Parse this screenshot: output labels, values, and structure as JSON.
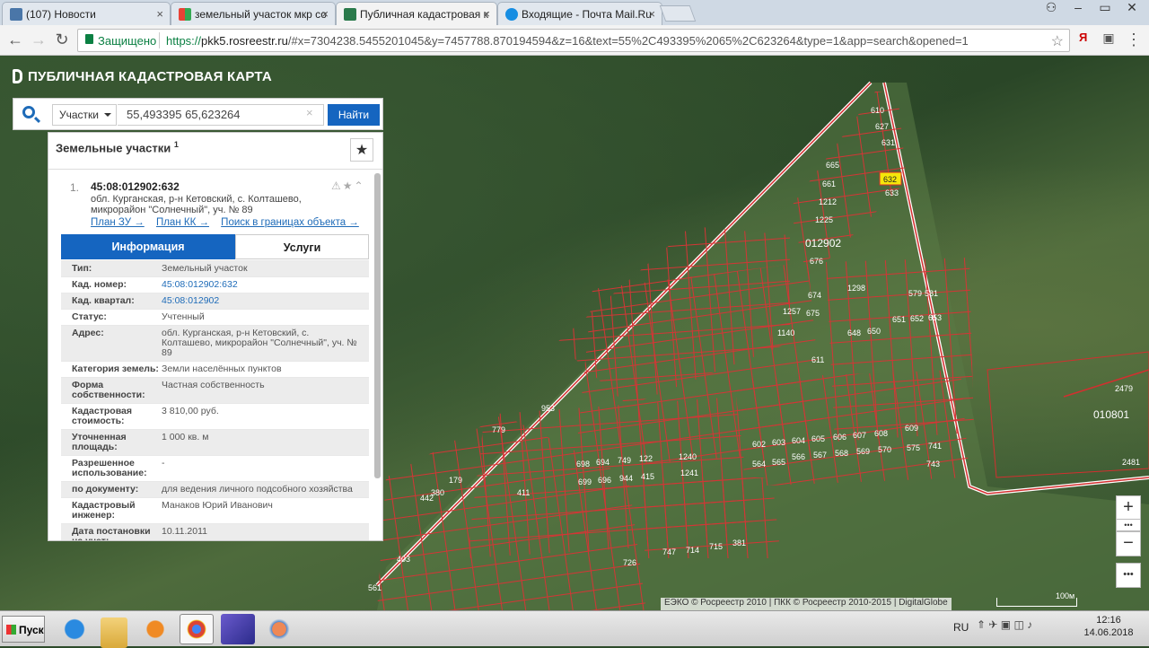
{
  "browser": {
    "tabs": [
      {
        "title": "(107) Новости",
        "favicon_color": "#4a76a8"
      },
      {
        "title": "земельный участок мкр со",
        "favicon_color": "#e94235"
      },
      {
        "title": "Публичная кадастровая к",
        "favicon_color": "#2a7a4b"
      },
      {
        "title": "Входящие - Почта Mail.Ru",
        "favicon_color": "#168de2"
      }
    ],
    "secure_label": "Защищено",
    "url_scheme": "https://",
    "url_host": "pkk5.rosreestr.ru",
    "url_rest": "/#x=7304238.5455201045&y=7457788.870194594&z=16&text=55%2C493395%2065%2C623264&type=1&app=search&opened=1",
    "ext_label": "Я"
  },
  "app": {
    "title": "ПУБЛИЧНАЯ КАДАСТРОВАЯ КАРТА"
  },
  "search": {
    "type_label": "Участки",
    "query": "55,493395 65,623264",
    "clear_icon": "×",
    "button_label": "Найти"
  },
  "panel": {
    "heading": "Земельные участки",
    "count": "1",
    "result": {
      "index": "1.",
      "title": "45:08:012902:632",
      "address_short": "обл. Курганская, р-н Кетовский, с. Колташево, микрорайон \"Солнечный\", уч. № 89",
      "links": [
        "План ЗУ →",
        "План КК →",
        "Поиск в границах объекта →"
      ]
    },
    "tabs": [
      "Информация",
      "Услуги"
    ],
    "rows": [
      {
        "k": "Тип:",
        "v": "Земельный участок"
      },
      {
        "k": "Кад. номер:",
        "v": "45:08:012902:632"
      },
      {
        "k": "Кад. квартал:",
        "v": "45:08:012902"
      },
      {
        "k": "Статус:",
        "v": "Учтенный"
      },
      {
        "k": "Адрес:",
        "v": "обл. Курганская, р-н Кетовский, с. Колташево, микрорайон \"Солнечный\", уч. № 89"
      },
      {
        "k": "Категория земель:",
        "v": "Земли населённых пунктов"
      },
      {
        "k": "Форма собственности:",
        "v": "Частная собственность"
      },
      {
        "k": "Кадастровая стоимость:",
        "v": "3 810,00 руб."
      },
      {
        "k": "Уточненная площадь:",
        "v": "1 000 кв. м"
      },
      {
        "k": "Разрешенное использование:",
        "v": "-"
      },
      {
        "k": "по документу:",
        "v": "для ведения личного подсобного хозяйства"
      },
      {
        "k": "Кадастровый инженер:",
        "v": "Манаков Юрий Иванович"
      },
      {
        "k": "Дата постановки на учет:",
        "v": "10.11.2011"
      }
    ]
  },
  "map": {
    "quarter_labels": [
      "012902",
      "010801"
    ],
    "parcel_labels": [
      "610",
      "627",
      "631",
      "632",
      "633",
      "665",
      "661",
      "1212",
      "1225",
      "676",
      "674",
      "1298",
      "1257",
      "675",
      "1140",
      "648",
      "650",
      "651",
      "652",
      "653",
      "611",
      "579",
      "581",
      "2479",
      "2481",
      "953",
      "779",
      "1240",
      "1241",
      "602",
      "603",
      "604",
      "605",
      "606",
      "607",
      "608",
      "609",
      "564",
      "565",
      "566",
      "567",
      "568",
      "569",
      "570",
      "575",
      "741",
      "743",
      "698",
      "694",
      "749",
      "122",
      "699",
      "696",
      "944",
      "415",
      "411",
      "179",
      "380",
      "442",
      "403",
      "561",
      "726",
      "747",
      "714",
      "715",
      "381"
    ],
    "attribution": "ЕЭКО © Росреестр 2010 | ПКК © Росреестр 2010-2015 | DigitalGlobe",
    "scale_label": "100м",
    "zoom_in": "+",
    "zoom_out": "−",
    "more": "•••"
  },
  "taskbar": {
    "start_label": "Пуск",
    "lang": "RU",
    "time": "12:16",
    "date": "14.06.2018"
  }
}
